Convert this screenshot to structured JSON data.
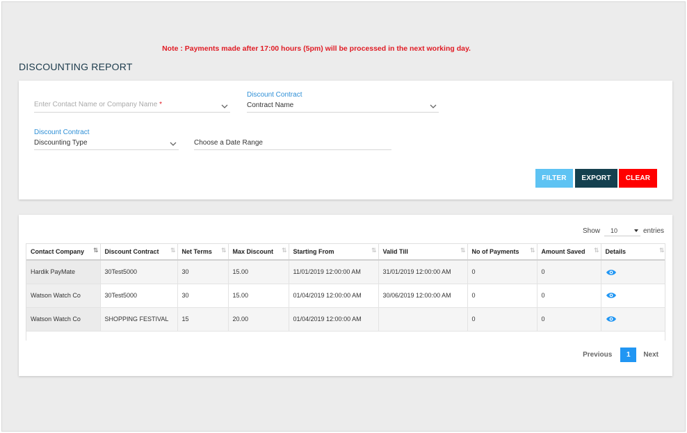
{
  "note": "Note : Payments made after 17:00 hours (5pm) will be processed in the next working day.",
  "page_title": "DISCOUNTING REPORT",
  "filters": {
    "contact": {
      "placeholder": "Enter Contact Name or Company Name",
      "required_mark": "*"
    },
    "contract_name": {
      "caption": "Discount Contract",
      "value": "Contract Name"
    },
    "discounting_type": {
      "caption": "Discount Contract",
      "value": "Discounting Type"
    },
    "date_range": {
      "value": "Choose a Date Range"
    }
  },
  "buttons": {
    "filter": "FILTER",
    "export": "EXPORT",
    "clear": "CLEAR"
  },
  "colors": {
    "filter": "#5ec3f3",
    "export": "#14404f",
    "clear": "#ff0000",
    "accent": "#2196f3",
    "note": "#e01b24"
  },
  "table": {
    "show_label": "Show",
    "entries_value": "10",
    "entries_label": "entries",
    "columns": [
      "Contact Company",
      "Discount Contract",
      "Net Terms",
      "Max Discount",
      "Starting From",
      "Valid Till",
      "No of Payments",
      "Amount Saved",
      "Details"
    ],
    "rows": [
      [
        "Hardik PayMate",
        "30Test5000",
        "30",
        "15.00",
        "11/01/2019 12:00:00 AM",
        "31/01/2019 12:00:00 AM",
        "0",
        "0"
      ],
      [
        "Watson Watch Co",
        "30Test5000",
        "30",
        "15.00",
        "01/04/2019 12:00:00 AM",
        "30/06/2019 12:00:00 AM",
        "0",
        "0"
      ],
      [
        "Watson Watch Co",
        "SHOPPING FESTIVAL",
        "15",
        "20.00",
        "01/04/2019 12:00:00 AM",
        "",
        "0",
        "0"
      ]
    ],
    "details_icon": "eye-icon"
  },
  "pagination": {
    "previous": "Previous",
    "current_page": "1",
    "next": "Next"
  }
}
